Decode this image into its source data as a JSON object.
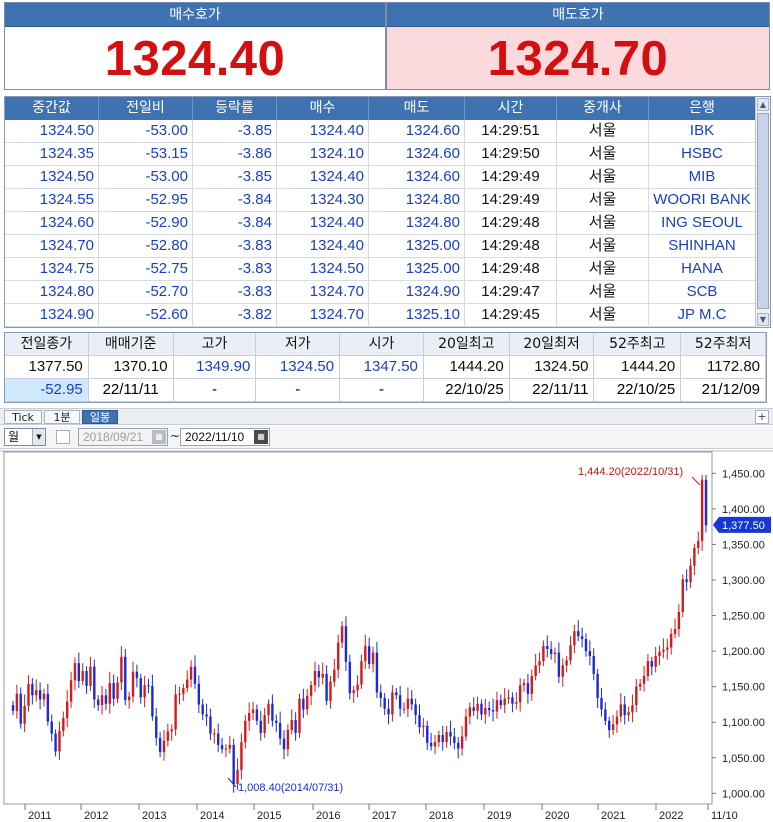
{
  "quotes": {
    "bid": {
      "label": "매수호가",
      "value": "1324.40"
    },
    "ask": {
      "label": "매도호가",
      "value": "1324.70"
    }
  },
  "trades": {
    "columns": [
      "중간값",
      "전일비",
      "등락률",
      "매수",
      "매도",
      "시간",
      "중개사",
      "은행"
    ],
    "rows": [
      [
        "1324.50",
        "-53.00",
        "-3.85",
        "1324.40",
        "1324.60",
        "14:29:51",
        "서울",
        "IBK"
      ],
      [
        "1324.35",
        "-53.15",
        "-3.86",
        "1324.10",
        "1324.60",
        "14:29:50",
        "서울",
        "HSBC"
      ],
      [
        "1324.50",
        "-53.00",
        "-3.85",
        "1324.40",
        "1324.60",
        "14:29:49",
        "서울",
        "MIB"
      ],
      [
        "1324.55",
        "-52.95",
        "-3.84",
        "1324.30",
        "1324.80",
        "14:29:49",
        "서울",
        "WOORI BANK"
      ],
      [
        "1324.60",
        "-52.90",
        "-3.84",
        "1324.40",
        "1324.80",
        "14:29:48",
        "서울",
        "ING SEOUL"
      ],
      [
        "1324.70",
        "-52.80",
        "-3.83",
        "1324.40",
        "1325.00",
        "14:29:48",
        "서울",
        "SHINHAN"
      ],
      [
        "1324.75",
        "-52.75",
        "-3.83",
        "1324.50",
        "1325.00",
        "14:29:48",
        "서울",
        "HANA"
      ],
      [
        "1324.80",
        "-52.70",
        "-3.83",
        "1324.70",
        "1324.90",
        "14:29:47",
        "서울",
        "SCB"
      ],
      [
        "1324.90",
        "-52.60",
        "-3.82",
        "1324.70",
        "1325.10",
        "14:29:45",
        "서울",
        "JP M.C"
      ]
    ]
  },
  "summary": {
    "headers": [
      "전일종가",
      "매매기준",
      "고가",
      "저가",
      "시가",
      "20일최고",
      "20일최저",
      "52주최고",
      "52주최저"
    ],
    "row1": [
      "1377.50",
      "1370.10",
      "1349.90",
      "1324.50",
      "1347.50",
      "1444.20",
      "1324.50",
      "1444.20",
      "1172.80"
    ],
    "row2": [
      "-52.95",
      "22/11/11",
      "-",
      "-",
      "-",
      "22/10/25",
      "22/11/11",
      "22/10/25",
      "21/12/09"
    ]
  },
  "tabs": {
    "tick": "Tick",
    "min1": "1분",
    "daily": "일봉",
    "add": "+"
  },
  "toolbar": {
    "period": "월",
    "date_from": "2018/09/21",
    "tilde": "~",
    "date_to": "2022/11/10"
  },
  "colors": {
    "header_blue": "#3f72b0",
    "up": "#d01c1c",
    "down": "#1a2bd6",
    "bid_red": "#d40f0f",
    "ask_bg": "#fcd9dc"
  },
  "icons": {
    "calendar": "calendar-icon",
    "dropdown": "chevron-down-icon",
    "scroll_up": "arrow-up-icon",
    "scroll_down": "arrow-down-icon"
  },
  "chart_data": {
    "type": "candlestick",
    "period": "monthly",
    "x_labels": [
      "2011",
      "2012",
      "2013",
      "2014",
      "2015",
      "2016",
      "2017",
      "2018",
      "2019",
      "2020",
      "2021",
      "2022",
      "11/10"
    ],
    "y_ticks": [
      "1,450.00",
      "1,400.00",
      "1,350.00",
      "1,300.00",
      "1,250.00",
      "1,200.00",
      "1,150.00",
      "1,100.00",
      "1,050.00",
      "1,000.00"
    ],
    "ylim": [
      985,
      1480
    ],
    "current_price": "1,377.50",
    "annotations": {
      "max": "1,444.20(2022/10/31)",
      "min": "1,008.40(2014/07/31)"
    },
    "closes": [
      1116,
      1140,
      1098,
      1123,
      1154,
      1138,
      1145,
      1132,
      1140,
      1101,
      1084,
      1059,
      1088,
      1106,
      1129,
      1159,
      1183,
      1158,
      1172,
      1151,
      1178,
      1132,
      1124,
      1138,
      1126,
      1155,
      1133,
      1156,
      1192,
      1131,
      1136,
      1171,
      1162,
      1135,
      1152,
      1151,
      1108,
      1078,
      1058,
      1074,
      1087,
      1090,
      1139,
      1140,
      1148,
      1160,
      1178,
      1154,
      1125,
      1111,
      1108,
      1084,
      1084,
      1068,
      1062,
      1063,
      1068,
      1013,
      1033,
      1072,
      1102,
      1113,
      1118,
      1102,
      1085,
      1110,
      1126,
      1102,
      1099,
      1077,
      1062,
      1089,
      1103,
      1085,
      1133,
      1118,
      1137,
      1152,
      1172,
      1163,
      1168,
      1130,
      1157,
      1174,
      1212,
      1235,
      1185,
      1141,
      1145,
      1153,
      1186,
      1207,
      1182,
      1198,
      1142,
      1134,
      1119,
      1111,
      1142,
      1138,
      1119,
      1119,
      1133,
      1125,
      1110,
      1093,
      1095,
      1071,
      1066,
      1072,
      1082,
      1072,
      1086,
      1080,
      1071,
      1063,
      1080,
      1108,
      1121,
      1116,
      1126,
      1111,
      1120,
      1117,
      1115,
      1131,
      1124,
      1133,
      1135,
      1126,
      1128,
      1152,
      1155,
      1140,
      1165,
      1180,
      1186,
      1207,
      1203,
      1196,
      1198,
      1164,
      1180,
      1187,
      1208,
      1228,
      1221,
      1217,
      1200,
      1193,
      1168,
      1134,
      1118,
      1102,
      1089,
      1097,
      1108,
      1125,
      1110,
      1114,
      1124,
      1150,
      1154,
      1165,
      1186,
      1178,
      1193,
      1199,
      1202,
      1205,
      1224,
      1231,
      1255,
      1301,
      1297,
      1320,
      1345,
      1355,
      1441,
      1377
    ]
  }
}
